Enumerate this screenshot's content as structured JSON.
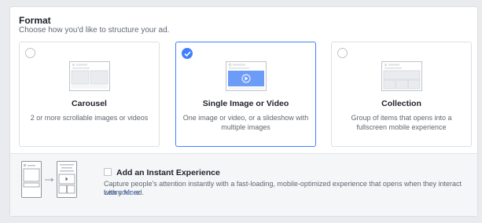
{
  "format": {
    "title": "Format",
    "subtitle": "Choose how you'd like to structure your ad."
  },
  "cards": [
    {
      "title": "Carousel",
      "description": "2 or more scrollable images or videos",
      "selected": false,
      "illustration": "carousel-preview-icon"
    },
    {
      "title": "Single Image or Video",
      "description": "One image or video, or a slideshow with multiple images",
      "selected": true,
      "illustration": "single-video-preview-icon"
    },
    {
      "title": "Collection",
      "description": "Group of items that opens into a fullscreen mobile experience",
      "selected": false,
      "illustration": "collection-preview-icon"
    }
  ],
  "instant_experience": {
    "title": "Add an Instant Experience",
    "description": "Capture people's attention instantly with a fast-loading, mobile-optimized experience that opens when they interact with your ad.",
    "link": "Learn More",
    "checked": false
  },
  "colors": {
    "accent": "#4080ff",
    "link": "#4267b2",
    "text": "#1d2129",
    "muted": "#606770",
    "border": "#dddfe2"
  }
}
